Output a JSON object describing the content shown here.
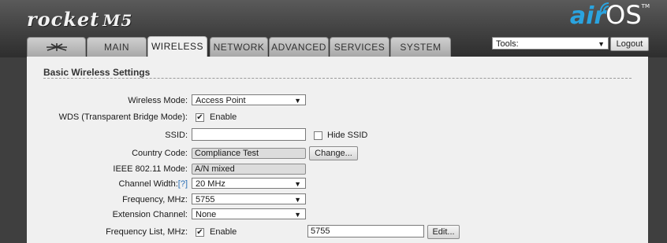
{
  "header": {
    "brand": "rocket",
    "model": "M5",
    "os_air": "air",
    "os_os": "OS",
    "os_tm": "TM"
  },
  "tabs": [
    {
      "label": ""
    },
    {
      "label": "MAIN"
    },
    {
      "label": "WIRELESS"
    },
    {
      "label": "NETWORK"
    },
    {
      "label": "ADVANCED"
    },
    {
      "label": "SERVICES"
    },
    {
      "label": "SYSTEM"
    }
  ],
  "tools": {
    "selected": "Tools:",
    "logout_label": "Logout"
  },
  "section": {
    "title": "Basic Wireless Settings"
  },
  "form": {
    "wireless_mode": {
      "label": "Wireless Mode:",
      "value": "Access Point"
    },
    "wds": {
      "label": "WDS (Transparent Bridge Mode):",
      "checkbox_label": "Enable",
      "checked": "✔"
    },
    "ssid": {
      "label": "SSID:",
      "value": "",
      "hide_label": "Hide SSID"
    },
    "country_code": {
      "label": "Country Code:",
      "value": "Compliance Test",
      "change_label": "Change..."
    },
    "ieee": {
      "label": "IEEE 802.11 Mode:",
      "value": "A/N mixed"
    },
    "channel_width": {
      "label": "Channel Width:",
      "help": "[?]",
      "value": "20 MHz"
    },
    "frequency": {
      "label": "Frequency, MHz:",
      "value": "5755"
    },
    "extension_channel": {
      "label": "Extension Channel:",
      "value": "None"
    },
    "frequency_list": {
      "label": "Frequency List, MHz:",
      "checkbox_label": "Enable",
      "checked": "✔",
      "value": "5755",
      "edit_label": "Edit..."
    }
  },
  "colors": {
    "accent_blue": "#2aa4e0",
    "header_dark": "#3f3f3f",
    "panel": "#f0f0f0"
  }
}
